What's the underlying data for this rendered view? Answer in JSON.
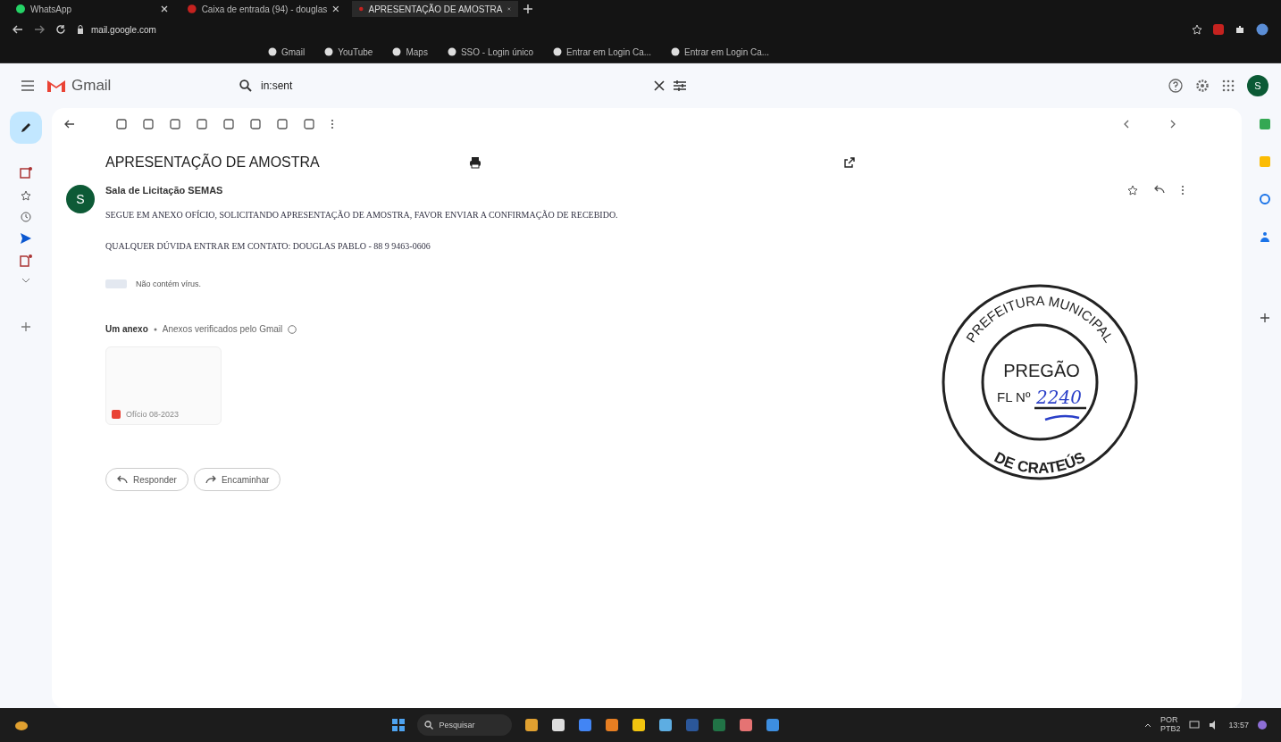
{
  "browser": {
    "tabs": [
      {
        "title": "WhatsApp",
        "selected": false
      },
      {
        "title": "Caixa de entrada (94) - douglas",
        "selected": false
      },
      {
        "title": "APRESENTAÇÃO DE AMOSTRA",
        "selected": true
      }
    ],
    "address": "mail.google.com",
    "bookmarks": [
      "Gmail",
      "YouTube",
      "Maps",
      "SSO - Login único",
      "Entrar em Login Ca...",
      "Entrar em Login Ca..."
    ]
  },
  "gmail": {
    "logo": "Gmail",
    "search": {
      "value": "in:sent"
    },
    "avatar": "S"
  },
  "email": {
    "subject": "APRESENTAÇÃO DE AMOSTRA",
    "sender": "Sala de Licitação SEMAS",
    "avatar": "S",
    "body": [
      "SEGUE EM ANEXO OFÍCIO, SOLICITANDO APRESENTAÇÃO DE AMOSTRA, FAVOR ENVIAR A CONFIRMAÇÃO DE RECEBIDO.",
      "QUALQUER DÚVIDA ENTRAR EM CONTATO: DOUGLAS PABLO - 88 9 9463-0606"
    ],
    "signature": "Não contém vírus.",
    "attachments": {
      "heading": "Um anexo",
      "note": "Anexos verificados pelo Gmail",
      "files": [
        {
          "name": "Ofício 08-2023"
        }
      ]
    },
    "buttons": [
      "Responder",
      "Encaminhar"
    ]
  },
  "stamp": {
    "ring_top": "PREFEITURA MUNICIPAL",
    "ring_bottom": "DE CRATEÚS",
    "center": "PREGÃO",
    "field_label": "FL Nº",
    "handwritten": "2240"
  },
  "taskbar": {
    "search": "Pesquisar",
    "language": "POR",
    "layout": "PTB2",
    "time": "13:57"
  }
}
